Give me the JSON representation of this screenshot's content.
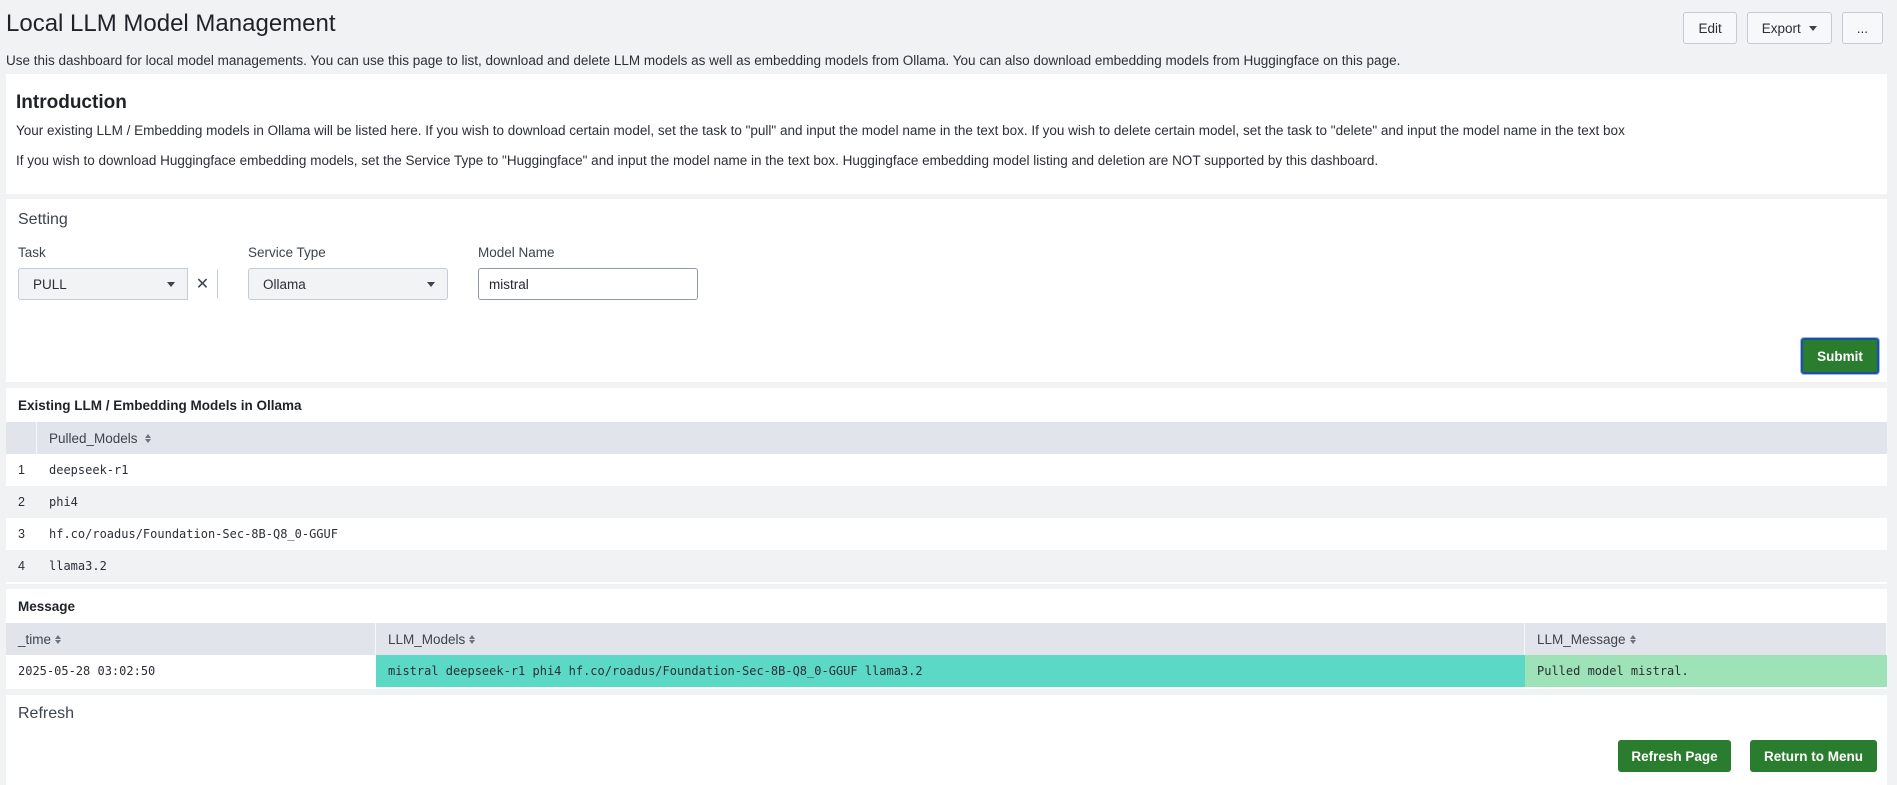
{
  "header": {
    "title": "Local LLM Model Management",
    "description": "Use this dashboard for local model managements. You can use this page to list, download and delete LLM models as well as embedding models from Ollama. You can also download embedding models from Huggingface on this page.",
    "edit_label": "Edit",
    "export_label": "Export",
    "more_label": "..."
  },
  "intro": {
    "title": "Introduction",
    "p1": "Your existing LLM / Embedding models in Ollama will be listed here. If you wish to download certain model, set the task to \"pull\" and input the model name in the text box. If you wish to delete certain model, set the task to \"delete\" and input the model name in the text box",
    "p2": "If you wish to download Huggingface embedding models, set the Service Type to \"Huggingface\" and input the model name in the text box. Huggingface embedding model listing and deletion are NOT supported by this dashboard."
  },
  "setting": {
    "title": "Setting",
    "task_label": "Task",
    "task_value": "PULL",
    "service_label": "Service Type",
    "service_value": "Ollama",
    "model_label": "Model Name",
    "model_value": "mistral",
    "submit_label": "Submit"
  },
  "models": {
    "title": "Existing LLM / Embedding Models in Ollama",
    "column": "Pulled_Models",
    "rows": [
      {
        "idx": "1",
        "name": "deepseek-r1"
      },
      {
        "idx": "2",
        "name": "phi4"
      },
      {
        "idx": "3",
        "name": "hf.co/roadus/Foundation-Sec-8B-Q8_0-GGUF"
      },
      {
        "idx": "4",
        "name": "llama3.2"
      }
    ]
  },
  "message": {
    "title": "Message",
    "columns": [
      "_time",
      "LLM_Models",
      "LLM_Message"
    ],
    "row": {
      "time": "2025-05-28 03:02:50",
      "models": "mistral deepseek-r1 phi4 hf.co/roadus/Foundation-Sec-8B-Q8_0-GGUF llama3.2",
      "message": "Pulled model mistral."
    }
  },
  "refresh": {
    "title": "Refresh",
    "refresh_label": "Refresh Page",
    "return_label": "Return to Menu"
  },
  "colors": {
    "accent_green": "#2a7c2e",
    "models_cell": "#5cd9c6",
    "message_cell": "#9ee2b8"
  }
}
